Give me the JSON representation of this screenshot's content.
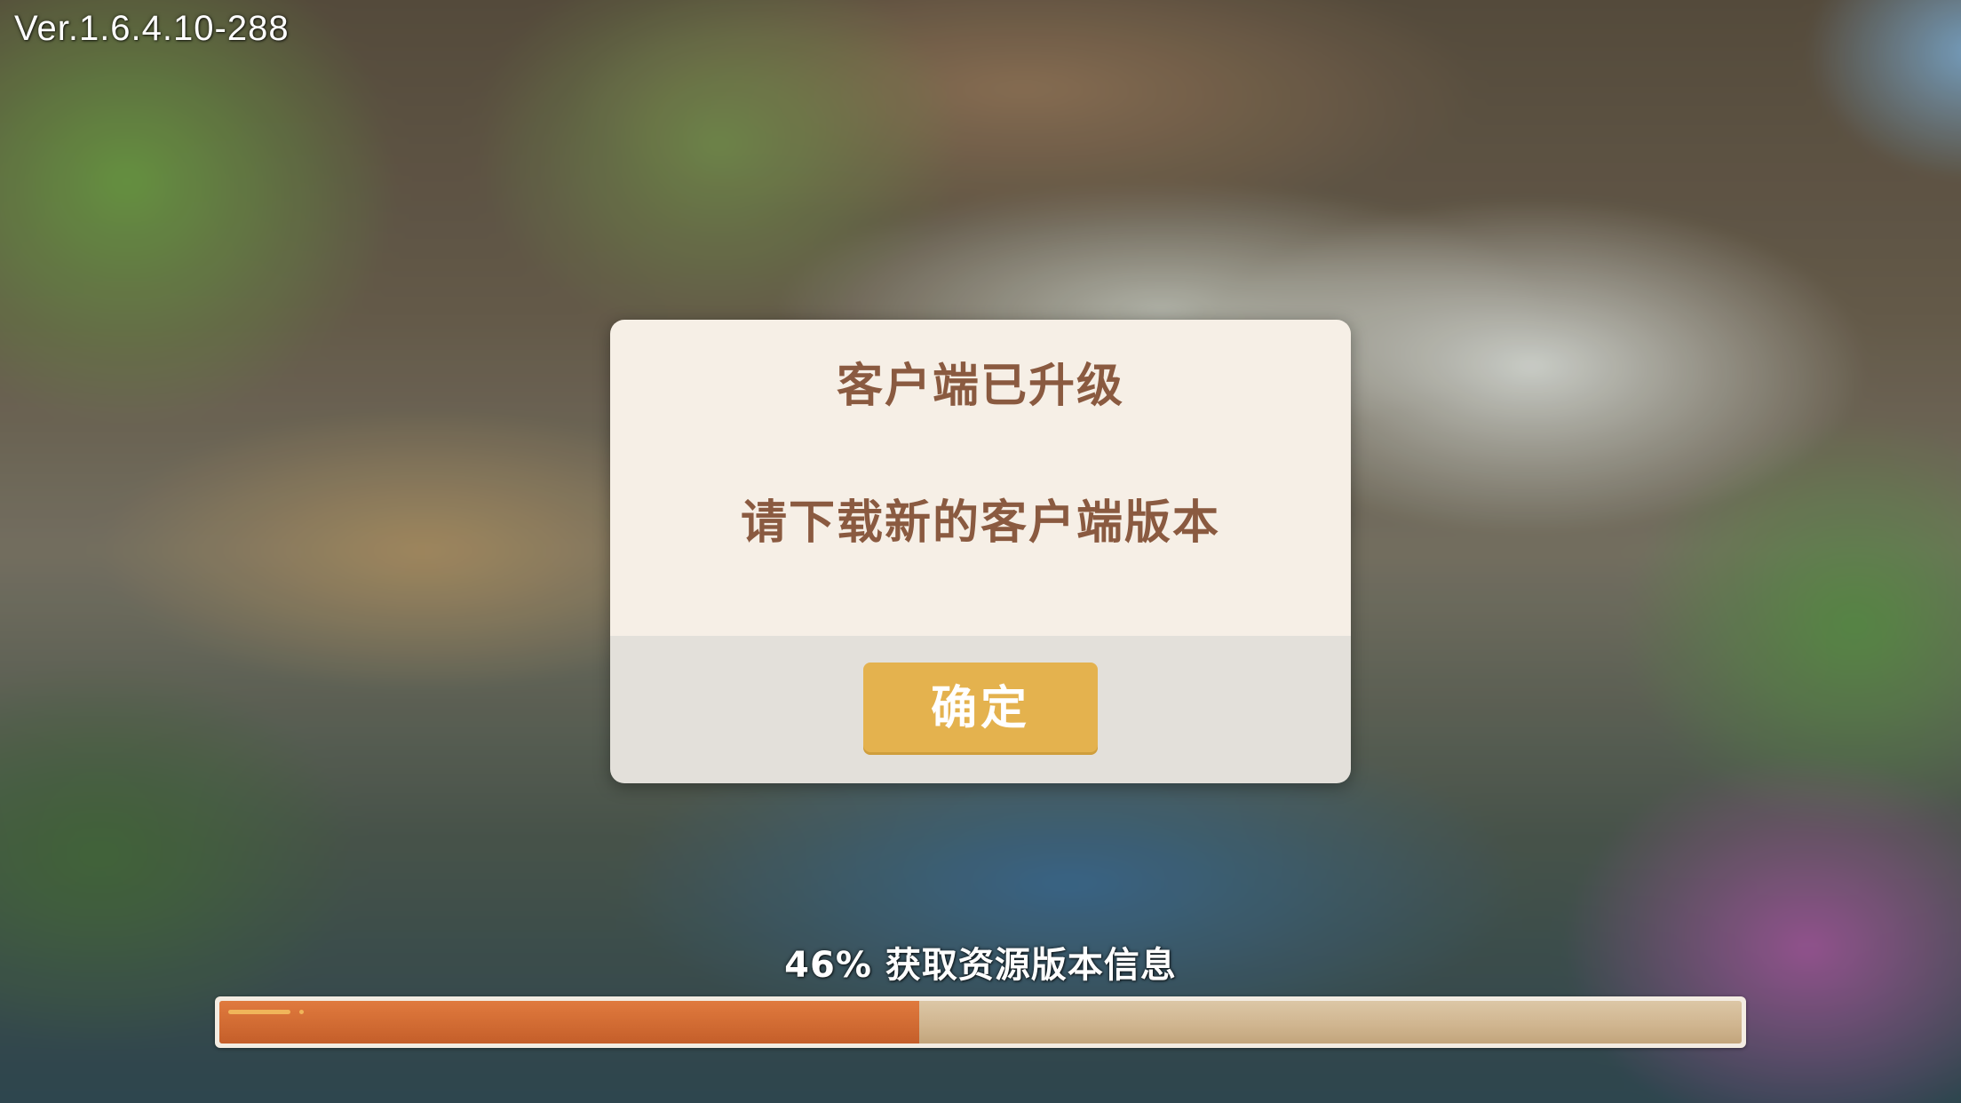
{
  "version": "Ver.1.6.4.10-288",
  "dialog": {
    "title": "客户端已升级",
    "message": "请下载新的客户端版本",
    "confirm_label": "确定"
  },
  "loading": {
    "status_text": "46% 获取资源版本信息",
    "progress": 0.46
  },
  "colors": {
    "dialog_text": "#8a5a40",
    "confirm_button": "#e4b24e",
    "progress_fill": "#d06a32"
  }
}
